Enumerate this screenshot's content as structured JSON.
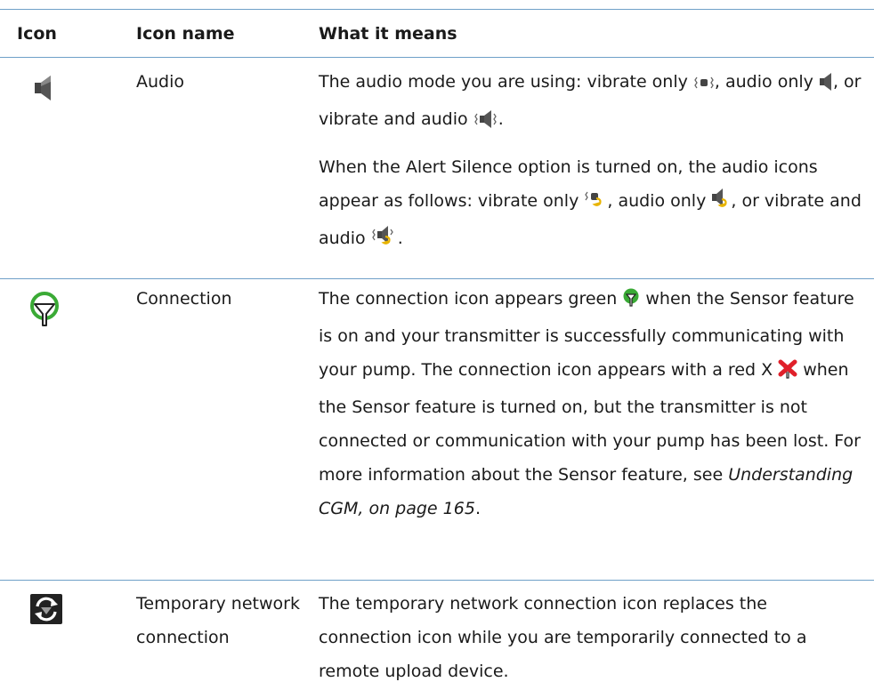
{
  "header": {
    "icon": "Icon",
    "icon_name": "Icon name",
    "meaning": "What it means"
  },
  "rows": [
    {
      "icon": "speaker-icon",
      "name": "Audio",
      "p1_a": "The audio mode you are using: vibrate only",
      "p1_b": ", audio only",
      "p1_c": ", or vibrate and audio",
      "p1_d": ".",
      "p2_a": "When the Alert Silence option is turned on, the audio icons appear as follows: vibrate only",
      "p2_b": ", audio only",
      "p2_c": ", or vibrate and audio",
      "p2_d": "."
    },
    {
      "icon": "connection-icon",
      "name": "Connection",
      "a": "The connection icon appears green",
      "b": "when the Sensor feature is on and your transmitter is successfully communicating with your pump. The connection icon appears with a red X",
      "c": "when the Sensor feature is turned on, but the transmitter is not connected or communication with your pump has been lost. For more information about the Sensor feature, see",
      "ref": "Understanding CGM, on page 165",
      "d": "."
    },
    {
      "icon": "temporary-network-icon",
      "name": "Temporary network connection",
      "text": "The temporary network connection icon replaces the connection icon while you are temporarily connected to a remote upload device."
    }
  ],
  "colors": {
    "rule": "#6fa0c8",
    "connection_green": "#3aaa35",
    "error_red": "#e0202a",
    "silence_yellow": "#e8b400"
  }
}
